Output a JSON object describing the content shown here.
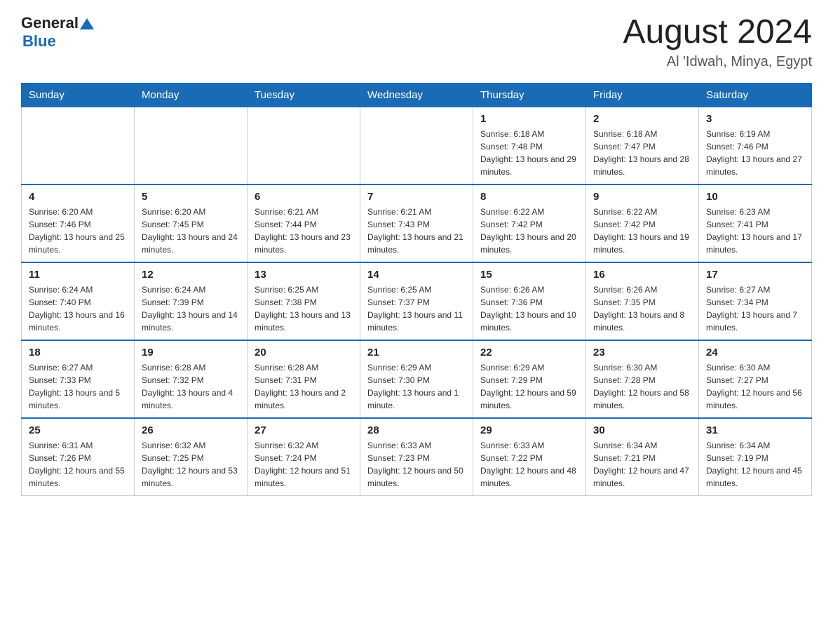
{
  "logo": {
    "general": "General",
    "blue": "Blue",
    "triangle": "▲"
  },
  "title": "August 2024",
  "subtitle": "Al 'Idwah, Minya, Egypt",
  "days_of_week": [
    "Sunday",
    "Monday",
    "Tuesday",
    "Wednesday",
    "Thursday",
    "Friday",
    "Saturday"
  ],
  "weeks": [
    [
      {
        "day": "",
        "info": ""
      },
      {
        "day": "",
        "info": ""
      },
      {
        "day": "",
        "info": ""
      },
      {
        "day": "",
        "info": ""
      },
      {
        "day": "1",
        "info": "Sunrise: 6:18 AM\nSunset: 7:48 PM\nDaylight: 13 hours and 29 minutes."
      },
      {
        "day": "2",
        "info": "Sunrise: 6:18 AM\nSunset: 7:47 PM\nDaylight: 13 hours and 28 minutes."
      },
      {
        "day": "3",
        "info": "Sunrise: 6:19 AM\nSunset: 7:46 PM\nDaylight: 13 hours and 27 minutes."
      }
    ],
    [
      {
        "day": "4",
        "info": "Sunrise: 6:20 AM\nSunset: 7:46 PM\nDaylight: 13 hours and 25 minutes."
      },
      {
        "day": "5",
        "info": "Sunrise: 6:20 AM\nSunset: 7:45 PM\nDaylight: 13 hours and 24 minutes."
      },
      {
        "day": "6",
        "info": "Sunrise: 6:21 AM\nSunset: 7:44 PM\nDaylight: 13 hours and 23 minutes."
      },
      {
        "day": "7",
        "info": "Sunrise: 6:21 AM\nSunset: 7:43 PM\nDaylight: 13 hours and 21 minutes."
      },
      {
        "day": "8",
        "info": "Sunrise: 6:22 AM\nSunset: 7:42 PM\nDaylight: 13 hours and 20 minutes."
      },
      {
        "day": "9",
        "info": "Sunrise: 6:22 AM\nSunset: 7:42 PM\nDaylight: 13 hours and 19 minutes."
      },
      {
        "day": "10",
        "info": "Sunrise: 6:23 AM\nSunset: 7:41 PM\nDaylight: 13 hours and 17 minutes."
      }
    ],
    [
      {
        "day": "11",
        "info": "Sunrise: 6:24 AM\nSunset: 7:40 PM\nDaylight: 13 hours and 16 minutes."
      },
      {
        "day": "12",
        "info": "Sunrise: 6:24 AM\nSunset: 7:39 PM\nDaylight: 13 hours and 14 minutes."
      },
      {
        "day": "13",
        "info": "Sunrise: 6:25 AM\nSunset: 7:38 PM\nDaylight: 13 hours and 13 minutes."
      },
      {
        "day": "14",
        "info": "Sunrise: 6:25 AM\nSunset: 7:37 PM\nDaylight: 13 hours and 11 minutes."
      },
      {
        "day": "15",
        "info": "Sunrise: 6:26 AM\nSunset: 7:36 PM\nDaylight: 13 hours and 10 minutes."
      },
      {
        "day": "16",
        "info": "Sunrise: 6:26 AM\nSunset: 7:35 PM\nDaylight: 13 hours and 8 minutes."
      },
      {
        "day": "17",
        "info": "Sunrise: 6:27 AM\nSunset: 7:34 PM\nDaylight: 13 hours and 7 minutes."
      }
    ],
    [
      {
        "day": "18",
        "info": "Sunrise: 6:27 AM\nSunset: 7:33 PM\nDaylight: 13 hours and 5 minutes."
      },
      {
        "day": "19",
        "info": "Sunrise: 6:28 AM\nSunset: 7:32 PM\nDaylight: 13 hours and 4 minutes."
      },
      {
        "day": "20",
        "info": "Sunrise: 6:28 AM\nSunset: 7:31 PM\nDaylight: 13 hours and 2 minutes."
      },
      {
        "day": "21",
        "info": "Sunrise: 6:29 AM\nSunset: 7:30 PM\nDaylight: 13 hours and 1 minute."
      },
      {
        "day": "22",
        "info": "Sunrise: 6:29 AM\nSunset: 7:29 PM\nDaylight: 12 hours and 59 minutes."
      },
      {
        "day": "23",
        "info": "Sunrise: 6:30 AM\nSunset: 7:28 PM\nDaylight: 12 hours and 58 minutes."
      },
      {
        "day": "24",
        "info": "Sunrise: 6:30 AM\nSunset: 7:27 PM\nDaylight: 12 hours and 56 minutes."
      }
    ],
    [
      {
        "day": "25",
        "info": "Sunrise: 6:31 AM\nSunset: 7:26 PM\nDaylight: 12 hours and 55 minutes."
      },
      {
        "day": "26",
        "info": "Sunrise: 6:32 AM\nSunset: 7:25 PM\nDaylight: 12 hours and 53 minutes."
      },
      {
        "day": "27",
        "info": "Sunrise: 6:32 AM\nSunset: 7:24 PM\nDaylight: 12 hours and 51 minutes."
      },
      {
        "day": "28",
        "info": "Sunrise: 6:33 AM\nSunset: 7:23 PM\nDaylight: 12 hours and 50 minutes."
      },
      {
        "day": "29",
        "info": "Sunrise: 6:33 AM\nSunset: 7:22 PM\nDaylight: 12 hours and 48 minutes."
      },
      {
        "day": "30",
        "info": "Sunrise: 6:34 AM\nSunset: 7:21 PM\nDaylight: 12 hours and 47 minutes."
      },
      {
        "day": "31",
        "info": "Sunrise: 6:34 AM\nSunset: 7:19 PM\nDaylight: 12 hours and 45 minutes."
      }
    ]
  ]
}
